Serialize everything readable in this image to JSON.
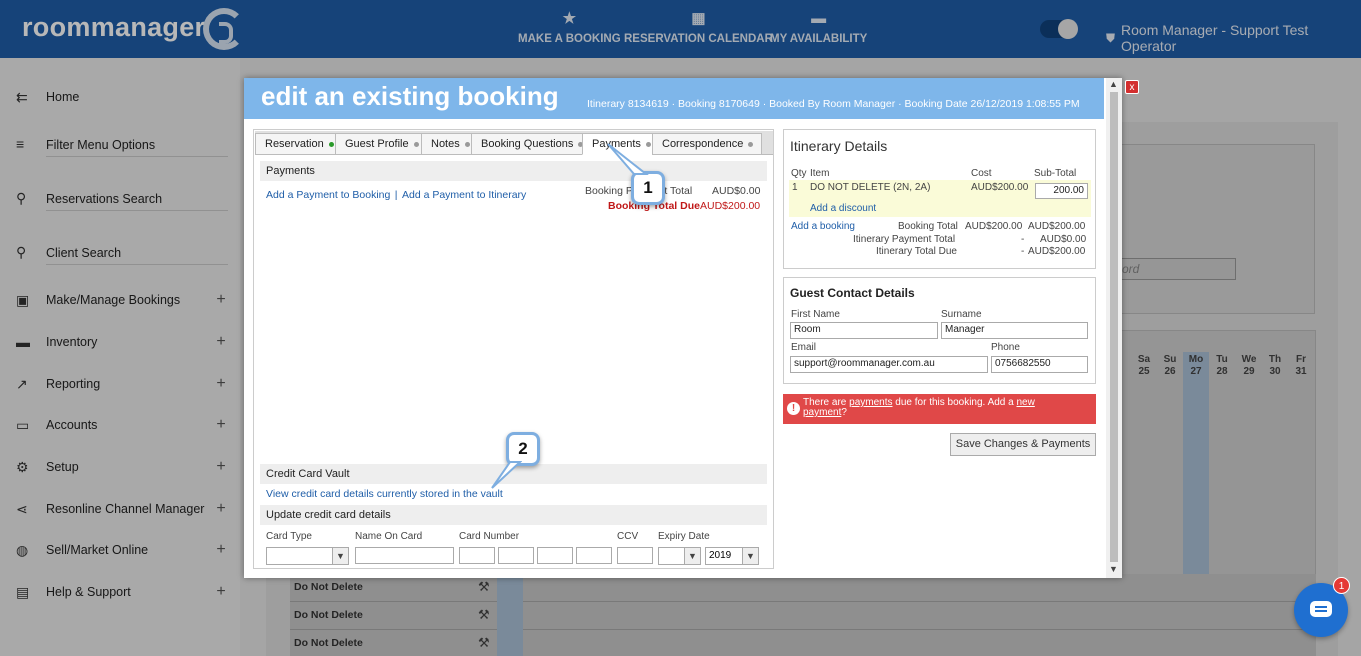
{
  "topbar": {
    "logo": "roommanager",
    "nav": [
      {
        "label": "MAKE A BOOKING",
        "icon": "star-icon"
      },
      {
        "label": "RESERVATION CALENDAR",
        "icon": "calendar-icon"
      },
      {
        "label": "MY AVAILABILITY",
        "icon": "bed-icon"
      }
    ],
    "user": "Room Manager - Support Test Operator"
  },
  "sidebar": {
    "items": [
      {
        "label": "Home",
        "icon": "arrow-left-icon"
      },
      {
        "label": "Filter Menu Options",
        "icon": "filter-icon"
      },
      {
        "label": "Reservations Search",
        "icon": "search-icon"
      },
      {
        "label": "Client Search",
        "icon": "search-icon"
      },
      {
        "label": "Make/Manage Bookings",
        "icon": "calendar-check-icon",
        "plus": "+"
      },
      {
        "label": "Inventory",
        "icon": "bed-icon",
        "plus": "+"
      },
      {
        "label": "Reporting",
        "icon": "trend-icon",
        "plus": "+"
      },
      {
        "label": "Accounts",
        "icon": "credit-card-icon",
        "plus": "+"
      },
      {
        "label": "Setup",
        "icon": "gear-icon",
        "plus": "+"
      },
      {
        "label": "Resonline Channel Manager",
        "icon": "share-icon",
        "plus": "+"
      },
      {
        "label": "Sell/Market Online",
        "icon": "globe-icon",
        "plus": "+"
      },
      {
        "label": "Help & Support",
        "icon": "chat-icon",
        "plus": "+"
      }
    ]
  },
  "background": {
    "search_placeholder": "ord",
    "days": [
      {
        "d": "Sa",
        "n": "25"
      },
      {
        "d": "Su",
        "n": "26"
      },
      {
        "d": "Mo",
        "n": "27"
      },
      {
        "d": "Tu",
        "n": "28"
      },
      {
        "d": "We",
        "n": "29"
      },
      {
        "d": "Th",
        "n": "30"
      },
      {
        "d": "Fr",
        "n": "31"
      }
    ],
    "rows": [
      "Do Not Delete",
      "Do Not Delete",
      "Do Not Delete",
      "Do Not Delete"
    ]
  },
  "modal": {
    "title": "edit an existing booking",
    "info": "Itinerary 8134619 · Booking 8170649 · Booked By Room Manager · Booking Date 26/12/2019 1:08:55 PM",
    "close": "x",
    "tabs": [
      {
        "label": "Reservation",
        "status": "ok"
      },
      {
        "label": "Guest Profile",
        "status": "none"
      },
      {
        "label": "Notes",
        "status": "none"
      },
      {
        "label": "Booking Questions",
        "status": "none"
      },
      {
        "label": "Payments",
        "status": "none"
      },
      {
        "label": "Correspondence",
        "status": "none"
      }
    ],
    "payments": {
      "heading": "Payments",
      "add_booking": "Add a Payment to Booking",
      "sep": "|",
      "add_itinerary": "Add a Payment to Itinerary",
      "paid_label": "Booking Payment Total",
      "paid_value": "AUD$0.00",
      "due_label": "Booking Total Due",
      "due_value": "AUD$200.00"
    },
    "vault": {
      "heading": "Credit Card Vault",
      "link": "View credit card details currently stored in the vault"
    },
    "update_cc": {
      "heading": "Update credit card details",
      "card_type": "Card Type",
      "name_on_card": "Name On Card",
      "card_number": "Card Number",
      "ccv": "CCV",
      "expiry": "Expiry Date",
      "year": "2019"
    },
    "itinerary": {
      "heading": "Itinerary Details",
      "col_qty": "Qty",
      "col_item": "Item",
      "col_cost": "Cost",
      "col_sub": "Sub-Total",
      "row_qty": "1",
      "row_item": "DO NOT DELETE (2N, 2A)",
      "row_cost": "AUD$200.00",
      "row_sub": "200.00",
      "discount_link": "Add a discount",
      "add_booking": "Add a booking",
      "booking_total_label": "Booking Total",
      "booking_total_cost": "AUD$200.00",
      "booking_total_sub": "AUD$200.00",
      "payment_total_label": "Itinerary Payment Total",
      "payment_total_cost": "-",
      "payment_total_sub": "AUD$0.00",
      "total_due_label": "Itinerary Total Due",
      "total_due_cost": "-",
      "total_due_sub": "AUD$200.00"
    },
    "contact": {
      "heading": "Guest Contact Details",
      "first_label": "First Name",
      "first_value": "Room",
      "surname_label": "Surname",
      "surname_value": "Manager",
      "email_label": "Email",
      "email_value": "support@roommanager.com.au",
      "phone_label": "Phone",
      "phone_value": "0756682550"
    },
    "alert": {
      "text1": "There are ",
      "link1": "payments",
      "text2": " due for this booking. Add a ",
      "link2a": "new",
      "link2b": "payment",
      "text3": "?"
    },
    "save_button": "Save Changes & Payments"
  },
  "callouts": [
    "1",
    "2"
  ],
  "chat": {
    "badge": "1"
  },
  "colors": {
    "topbar": "#1f5ea8",
    "modal_header": "#7eb6ea",
    "alert": "#e04848",
    "due_red": "#c01818",
    "link": "#1f5ea8"
  }
}
